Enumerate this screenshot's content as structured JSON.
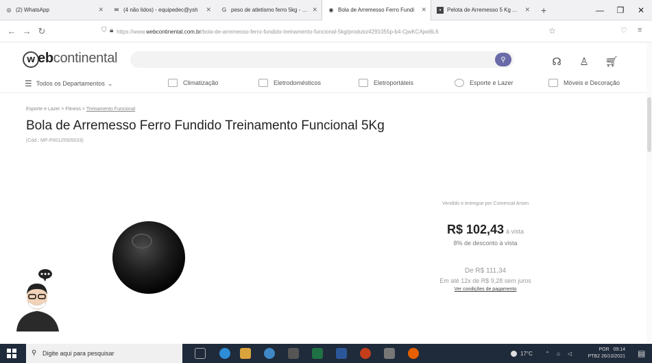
{
  "browser": {
    "tabs": [
      {
        "label": "(2) WhatsApp",
        "icon": "whatsapp-icon"
      },
      {
        "label": "(4 não lidos) - equipedec@ysh",
        "icon": "mail-icon"
      },
      {
        "label": "peso de atletismo ferro 5kg - Pe",
        "icon": "google-icon"
      },
      {
        "label": "Bola de Arremesso Ferro Fundi",
        "icon": "page-icon",
        "active": true
      },
      {
        "label": "Pelota de Arremesso 5 Kg AX Es",
        "icon": "page-icon"
      }
    ],
    "url_prefix": "https://www.",
    "url_domain": "webcontinental.com.br",
    "url_path": "/bola-de-arremesso-ferro-fundido-treinamento-funcional-5kg/produto/4291055p-b4-CjwKCAjwi6L6"
  },
  "site": {
    "logo_prefix": "w",
    "logo_bold": "eb",
    "logo_rest": "continental",
    "brand_color": "#6a6aa8"
  },
  "nav": {
    "all_departments": "Todos os Departamentos",
    "items": [
      "Climatização",
      "Eletrodomésticos",
      "Eletroportáteis",
      "Esporte e Lazer",
      "Móveis e Decoração"
    ]
  },
  "product": {
    "breadcrumb_1": "Esporte e Lazer",
    "breadcrumb_2": "Fitness",
    "breadcrumb_3": "Treinamento Funcional",
    "title": "Bola de Arremesso Ferro Fundido Treinamento Funcional 5Kg",
    "code": "(Cód.: MP-P00125505033)",
    "seller": "Vendido e entregue por Comercial Arsen",
    "price": "R$ 102,43",
    "price_suffix": "à vista",
    "discount": "8% de desconto à vista",
    "old_price": "De R$ 111,34",
    "installments": "Em até 12x de R$ 9,28 sem juros",
    "conditions_link": "Ver condições de pagamento"
  },
  "taskbar": {
    "search_placeholder": "Digite aqui para pesquisar",
    "temperature": "17°C",
    "lang_1": "POR",
    "lang_2": "PTB2",
    "time": "09:14",
    "date": "26/10/2021"
  }
}
